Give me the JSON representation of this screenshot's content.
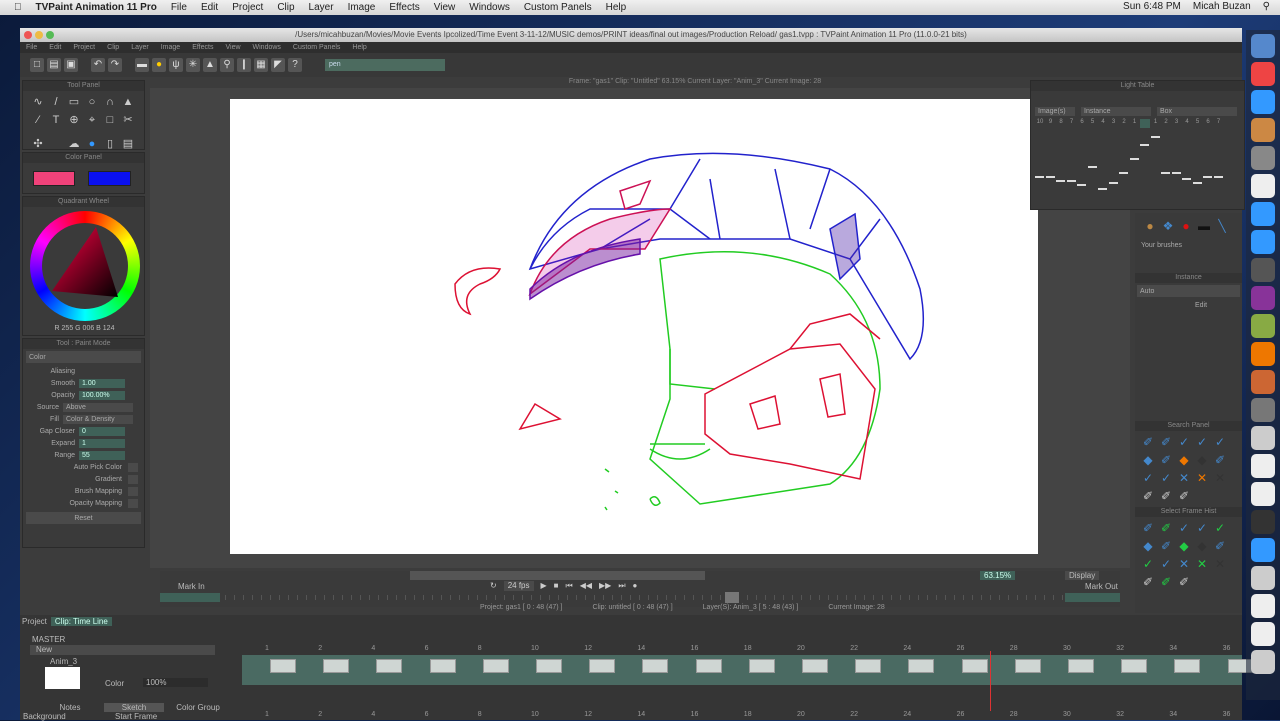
{
  "mac_menu": {
    "app": "TVPaint Animation 11 Pro",
    "items": [
      "File",
      "Edit",
      "Project",
      "Clip",
      "Layer",
      "Image",
      "Effects",
      "View",
      "Windows",
      "Custom Panels",
      "Help"
    ],
    "clock": "Sun 6:48 PM",
    "user": "Micah Buzan"
  },
  "window": {
    "title": "/Users/micahbuzan/Movies/Movie Events Ipcolized/Time Event 3-11-12/MUSIC demos/PRINT ideas/final out images/Production Reload/ gas1.tvpp : TVPaint Animation 11 Pro (11.0.0-21 bits)",
    "menu": [
      "File",
      "Edit",
      "Project",
      "Clip",
      "Layer",
      "Image",
      "Effects",
      "View",
      "Windows",
      "Custom Panels",
      "Help"
    ],
    "brush_field": "pen",
    "info": "Frame: \"gas1\" Clip: \"Untitled\" 63.15%   Current Layer: \"Anim_3\"  Current Image: 28"
  },
  "panels": {
    "tool_panel": "Tool Panel",
    "color_panel": "Color Panel",
    "color_wheel": "Quadrant Wheel",
    "rgb_readout": "R 255 G 006 B 124",
    "colors": {
      "primary": "#f0427a",
      "secondary": "#0a10f0"
    },
    "tool_options": {
      "title": "Tool : Paint Mode",
      "mode": "Color",
      "antialiasing": "Aliasing",
      "smooth_label": "Smooth",
      "smooth": "1.00",
      "opacity_label": "Opacity",
      "opacity": "100.00%",
      "source_label": "Source",
      "source": "Above",
      "fill_label": "Fill",
      "fill": "Color & Density",
      "gap_label": "Gap Closer",
      "gap": "0",
      "expand_label": "Expand",
      "expand": "1",
      "range_label": "Range",
      "range": "55",
      "auto_pick": "Auto Pick Color",
      "gradient": "Gradient",
      "brush_mapping": "Brush Mapping",
      "opacity_mapping": "Opacity Mapping",
      "reset": "Reset"
    }
  },
  "light_table": {
    "title": "Light Table",
    "mode": "Image(s)",
    "blend": "Instance",
    "color": "Box",
    "before": [
      "10",
      "9",
      "8",
      "7",
      "6",
      "5",
      "4",
      "3",
      "2",
      "1"
    ],
    "after": [
      "1",
      "2",
      "3",
      "4",
      "5",
      "6",
      "7"
    ]
  },
  "right": {
    "custom_brushes": "Your brushes",
    "notebook": "Instance",
    "auto": "Auto",
    "edit": "Edit",
    "search_panel": "Search Panel",
    "select_panel": "Select Frame Hist"
  },
  "transport": {
    "mark_in": "Mark In",
    "mark_out": "Mark Out",
    "fps": "24 fps",
    "zoom": "63.15%",
    "display": "Display",
    "status": [
      "Project: gas1 [ 0 : 48 (47) ]",
      "Clip: untitled [ 0 : 48 (47) ]",
      "Layer(S): Anim_3 [ 5 : 48 (43) ]",
      "Current Image: 28"
    ]
  },
  "timeline": {
    "tabs": [
      "Project",
      "Clip: Time Line"
    ],
    "master": "MASTER",
    "group": "New",
    "layer": "Anim_3",
    "opacity": "100%",
    "color_label": "Color",
    "bottom_tabs": [
      "Notes",
      "Sketch",
      "Color Group"
    ],
    "background": "Background",
    "start_frame": "Start Frame",
    "frames": [
      "1",
      "2",
      "4",
      "6",
      "8",
      "10",
      "12",
      "14",
      "16",
      "18",
      "20",
      "22",
      "24",
      "26",
      "28",
      "30",
      "32",
      "34",
      "36"
    ]
  }
}
